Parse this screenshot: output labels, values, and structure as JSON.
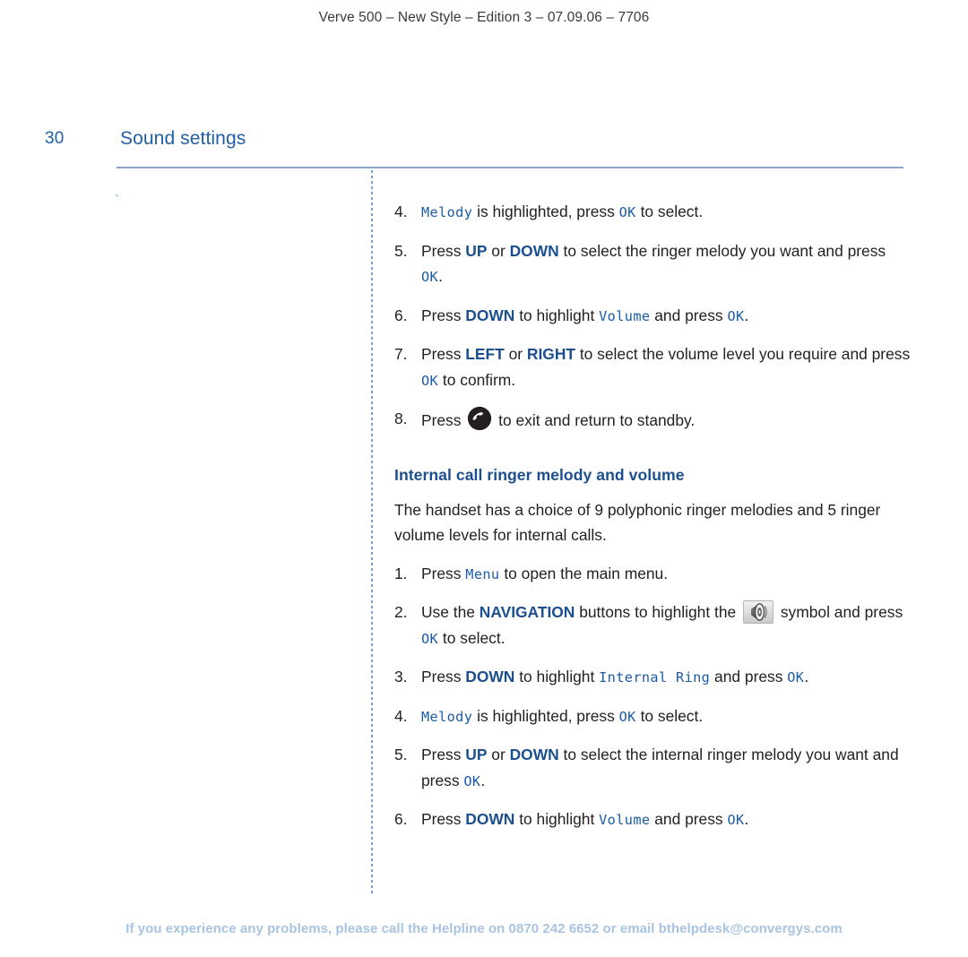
{
  "header": {
    "running_head": "Verve 500 – New Style – Edition 3 – 07.09.06 – 7706"
  },
  "page": {
    "number": "30",
    "title": "Sound settings",
    "left_column_mark": "`"
  },
  "colors": {
    "title_blue": "#1f5fa8",
    "key_navy": "#1b4f8f",
    "lcd_blue": "#1a5ba8",
    "rule_blue": "#8ba6c4",
    "divider_blue": "#7ba3cf",
    "footer_blue": "#a8c4e0",
    "body_text": "#231f20"
  },
  "external_ringer_steps": [
    {
      "num": "4.",
      "parts": [
        {
          "type": "lcd",
          "text": "Melody"
        },
        {
          "type": "text",
          "text": " is highlighted, press "
        },
        {
          "type": "lcd",
          "text": "OK"
        },
        {
          "type": "text",
          "text": " to select."
        }
      ]
    },
    {
      "num": "5.",
      "parts": [
        {
          "type": "text",
          "text": "Press "
        },
        {
          "type": "key",
          "text": "UP"
        },
        {
          "type": "text",
          "text": " or "
        },
        {
          "type": "key",
          "text": "DOWN"
        },
        {
          "type": "text",
          "text": " to select the ringer melody you want and press "
        },
        {
          "type": "lcd",
          "text": "OK"
        },
        {
          "type": "text",
          "text": "."
        }
      ]
    },
    {
      "num": "6.",
      "parts": [
        {
          "type": "text",
          "text": "Press "
        },
        {
          "type": "key",
          "text": "DOWN"
        },
        {
          "type": "text",
          "text": " to highlight "
        },
        {
          "type": "lcd",
          "text": "Volume"
        },
        {
          "type": "text",
          "text": " and press "
        },
        {
          "type": "lcd",
          "text": "OK"
        },
        {
          "type": "text",
          "text": "."
        }
      ]
    },
    {
      "num": "7.",
      "parts": [
        {
          "type": "text",
          "text": "Press "
        },
        {
          "type": "key",
          "text": "LEFT"
        },
        {
          "type": "text",
          "text": " or "
        },
        {
          "type": "key",
          "text": "RIGHT"
        },
        {
          "type": "text",
          "text": " to select the volume level you require and press "
        },
        {
          "type": "lcd",
          "text": "OK"
        },
        {
          "type": "text",
          "text": " to confirm."
        }
      ]
    },
    {
      "num": "8.",
      "parts": [
        {
          "type": "text",
          "text": "Press "
        },
        {
          "type": "icon",
          "icon": "end-call-icon"
        },
        {
          "type": "text",
          "text": " to exit and return to standby."
        }
      ]
    }
  ],
  "internal_section": {
    "heading": "Internal call ringer melody and volume",
    "intro": "The handset has a choice of 9 polyphonic ringer melodies and 5 ringer volume levels for internal calls.",
    "steps": [
      {
        "num": "1.",
        "parts": [
          {
            "type": "text",
            "text": "Press "
          },
          {
            "type": "lcd",
            "text": "Menu"
          },
          {
            "type": "text",
            "text": " to open the main menu."
          }
        ]
      },
      {
        "num": "2.",
        "parts": [
          {
            "type": "text",
            "text": "Use the "
          },
          {
            "type": "key",
            "text": "NAVIGATION"
          },
          {
            "type": "text",
            "text": " buttons to highlight the "
          },
          {
            "type": "icon",
            "icon": "speaker-symbol-icon"
          },
          {
            "type": "text",
            "text": " symbol and press "
          },
          {
            "type": "lcd",
            "text": "OK"
          },
          {
            "type": "text",
            "text": " to select."
          }
        ]
      },
      {
        "num": "3.",
        "parts": [
          {
            "type": "text",
            "text": "Press "
          },
          {
            "type": "key",
            "text": "DOWN"
          },
          {
            "type": "text",
            "text": " to highlight "
          },
          {
            "type": "lcd",
            "text": "Internal Ring"
          },
          {
            "type": "text",
            "text": " and press "
          },
          {
            "type": "lcd",
            "text": "OK"
          },
          {
            "type": "text",
            "text": "."
          }
        ]
      },
      {
        "num": "4.",
        "parts": [
          {
            "type": "lcd",
            "text": "Melody"
          },
          {
            "type": "text",
            "text": " is highlighted, press "
          },
          {
            "type": "lcd",
            "text": "OK"
          },
          {
            "type": "text",
            "text": " to select."
          }
        ]
      },
      {
        "num": "5.",
        "parts": [
          {
            "type": "text",
            "text": "Press "
          },
          {
            "type": "key",
            "text": "UP"
          },
          {
            "type": "text",
            "text": " or "
          },
          {
            "type": "key",
            "text": "DOWN"
          },
          {
            "type": "text",
            "text": " to select the internal ringer melody you want and press "
          },
          {
            "type": "lcd",
            "text": "OK"
          },
          {
            "type": "text",
            "text": "."
          }
        ]
      },
      {
        "num": "6.",
        "parts": [
          {
            "type": "text",
            "text": "Press "
          },
          {
            "type": "key",
            "text": "DOWN"
          },
          {
            "type": "text",
            "text": " to highlight "
          },
          {
            "type": "lcd",
            "text": "Volume"
          },
          {
            "type": "text",
            "text": " and press "
          },
          {
            "type": "lcd",
            "text": "OK"
          },
          {
            "type": "text",
            "text": "."
          }
        ]
      }
    ]
  },
  "footer": {
    "helpline": "If you experience any problems, please call the Helpline on 0870 242 6652 or email bthelpdesk@convergys.com"
  }
}
